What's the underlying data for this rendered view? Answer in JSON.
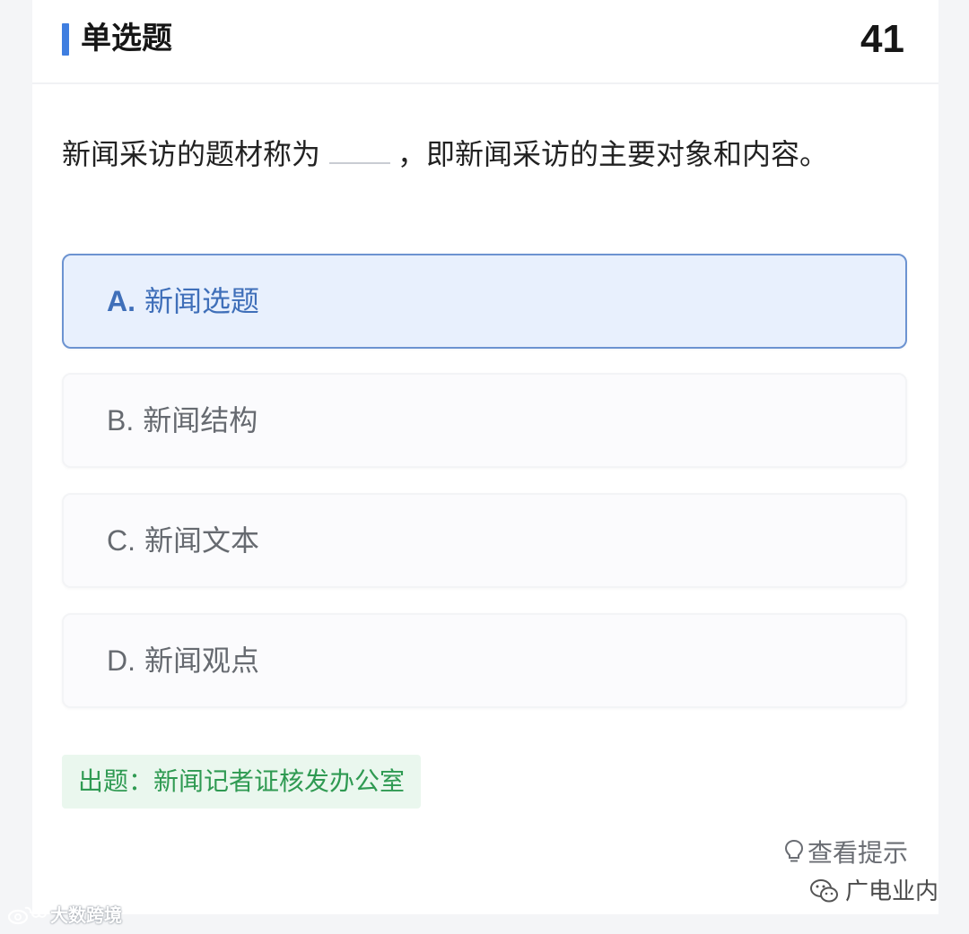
{
  "header": {
    "title": "单选题",
    "question_number": "41"
  },
  "question": {
    "stem_before": "新闻采访的题材称为",
    "stem_after": "，即新闻采访的主要对象和内容。"
  },
  "options": [
    {
      "letter": "A.",
      "text": "新闻选题",
      "selected": true
    },
    {
      "letter": "B.",
      "text": "新闻结构",
      "selected": false
    },
    {
      "letter": "C.",
      "text": "新闻文本",
      "selected": false
    },
    {
      "letter": "D.",
      "text": "新闻观点",
      "selected": false
    }
  ],
  "source": "出题：新闻记者证核发办公室",
  "hint": {
    "icon": "lightbulb-icon",
    "label": "查看提示"
  },
  "watermarks": {
    "right": {
      "icon": "wechat-icon",
      "text": "广电业内"
    },
    "left": {
      "icon": "weibo-icon",
      "text": "大数跨境"
    }
  },
  "colors": {
    "accent": "#3f7ee0",
    "selected_bg": "#e8f0fd",
    "selected_text": "#3f6fb9",
    "source_green": "#2f9a52"
  }
}
